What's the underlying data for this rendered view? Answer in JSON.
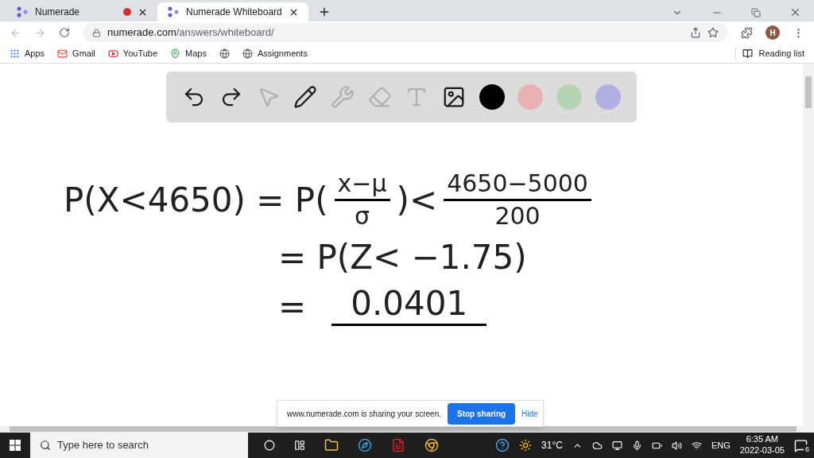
{
  "tabs": [
    {
      "title": "Numerade",
      "recording": true,
      "selected": false
    },
    {
      "title": "Numerade Whiteboard",
      "recording": false,
      "selected": true
    }
  ],
  "address_bar": {
    "url_host": "numerade.com",
    "url_path": "/answers/whiteboard/"
  },
  "profile": {
    "initial": "H"
  },
  "bookmarks": [
    {
      "kind": "apps",
      "label": "Apps"
    },
    {
      "kind": "gmail",
      "label": "Gmail"
    },
    {
      "kind": "youtube",
      "label": "YouTube"
    },
    {
      "kind": "maps",
      "label": "Maps"
    },
    {
      "kind": "globe"
    },
    {
      "kind": "globe",
      "label": "Assignments"
    }
  ],
  "reading_list": {
    "label": "Reading list"
  },
  "toolbar": {
    "tools": [
      {
        "kind": "undo",
        "disabled": false
      },
      {
        "kind": "redo",
        "disabled": false
      },
      {
        "kind": "select",
        "disabled": true
      },
      {
        "kind": "pen",
        "disabled": false
      },
      {
        "kind": "shapes",
        "disabled": true
      },
      {
        "kind": "eraser",
        "disabled": true
      },
      {
        "kind": "text",
        "disabled": true
      },
      {
        "kind": "image",
        "disabled": false
      }
    ],
    "colors": [
      {
        "color": "#000000"
      },
      {
        "color": "#e8b0b0"
      },
      {
        "color": "#b4d4b4"
      },
      {
        "color": "#b0b0e4"
      }
    ]
  },
  "whiteboard": {
    "lines": [
      [
        {
          "kind": "text",
          "text": "P(X<4650) = P("
        },
        {
          "kind": "fraction",
          "numerator": "x−μ",
          "denominator": "σ"
        },
        {
          "kind": "text",
          "text": ")<"
        },
        {
          "kind": "fraction",
          "numerator": "4650−5000",
          "denominator": "200"
        }
      ],
      [
        {
          "kind": "text",
          "text": "= P(Z< −1.75)"
        }
      ],
      [
        {
          "kind": "text",
          "text": "="
        },
        {
          "kind": "underlined",
          "text": "0.0401"
        }
      ]
    ]
  },
  "sharing_bar": {
    "message": "www.numerade.com is sharing your screen.",
    "stop_button": "Stop sharing",
    "hide_link": "Hide"
  },
  "taskbar": {
    "search_placeholder": "Type here to search",
    "temperature": "31°C",
    "language": "ENG",
    "time": "6:35 AM",
    "date": "2022-03-05",
    "notifications": "6"
  }
}
